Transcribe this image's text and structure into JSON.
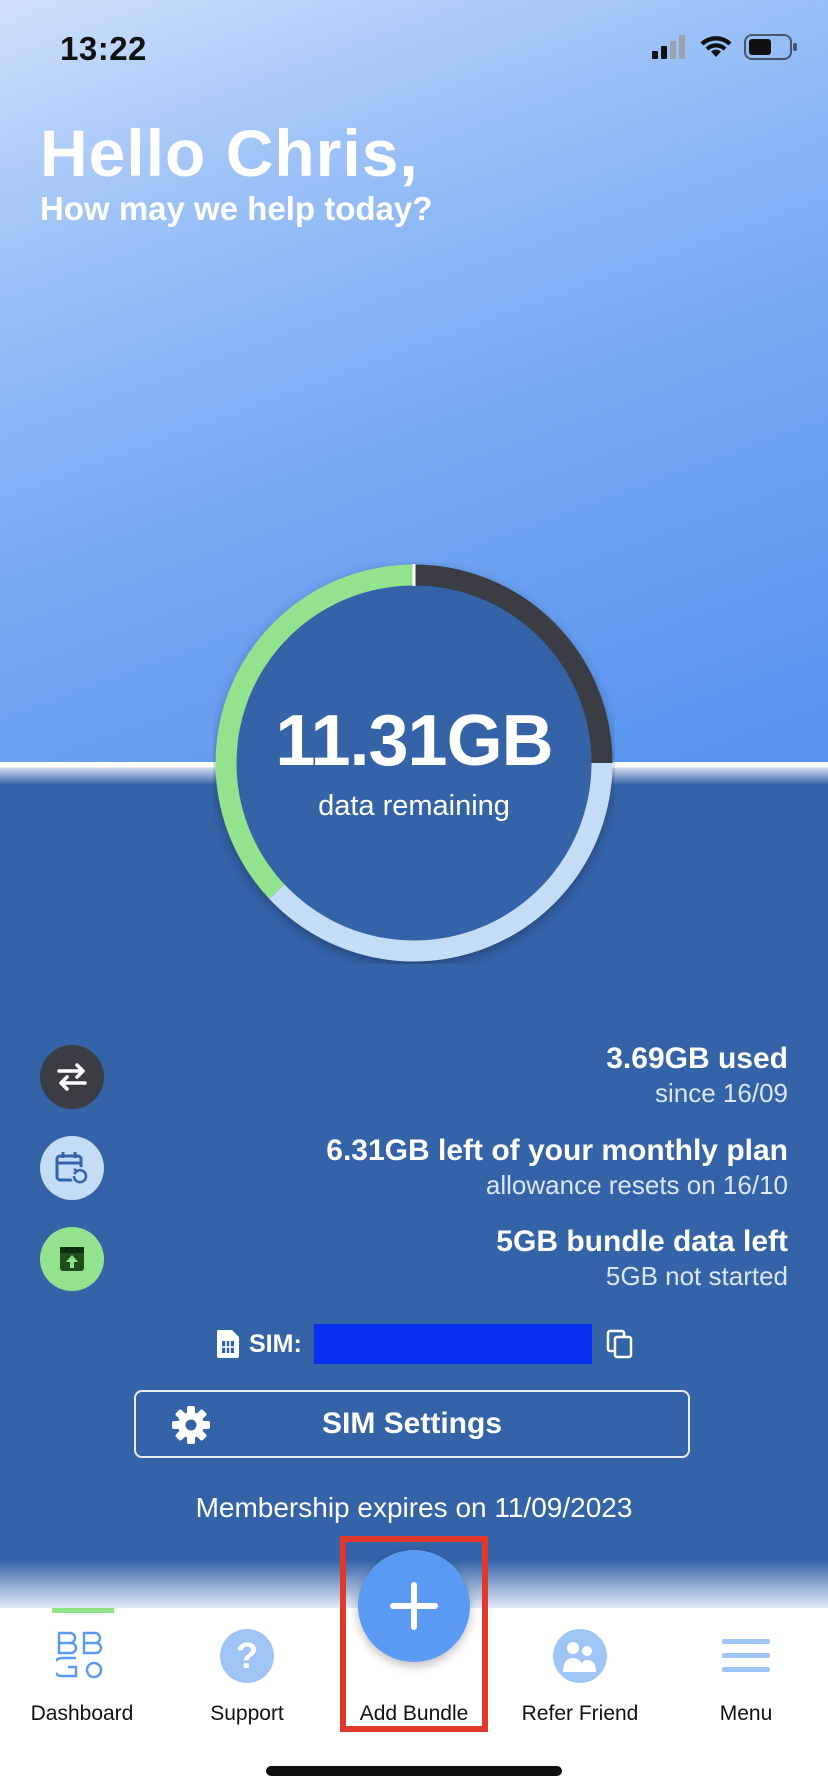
{
  "status_bar": {
    "time": "13:22"
  },
  "greeting": {
    "title": "Hello Chris,",
    "subtitle": "How may we help today?"
  },
  "data_gauge": {
    "value": "11.31GB",
    "label": "data remaining",
    "segments": {
      "used_fraction": 0.25,
      "monthly_remaining_fraction": 0.38,
      "bundle_fraction": 0.37
    },
    "colors": {
      "used": "#3a3d44",
      "monthly": "#c5dcf6",
      "bundle": "#93e28e"
    }
  },
  "stats": [
    {
      "icon": "transfer-arrows-icon",
      "main": "3.69GB used",
      "sub": "since 16/09"
    },
    {
      "icon": "calendar-reset-icon",
      "main": "6.31GB left of your monthly plan",
      "sub": "allowance resets on 16/10"
    },
    {
      "icon": "bundle-box-icon",
      "main": "5GB bundle data left",
      "sub": "5GB not started"
    }
  ],
  "sim": {
    "label": "SIM:"
  },
  "sim_settings_button": {
    "label": "SIM Settings"
  },
  "membership": {
    "text": "Membership expires on 11/09/2023"
  },
  "tabbar": {
    "items": [
      {
        "label": "Dashboard",
        "icon": "bbgo-logo-icon"
      },
      {
        "label": "Support",
        "icon": "question-icon"
      },
      {
        "label": "Add Bundle",
        "icon": "plus-icon"
      },
      {
        "label": "Refer Friend",
        "icon": "people-icon"
      },
      {
        "label": "Menu",
        "icon": "hamburger-icon"
      }
    ]
  },
  "colors": {
    "accent": "#5b9af2",
    "background_dark": "#3463a8",
    "highlight": "#e0392b"
  }
}
